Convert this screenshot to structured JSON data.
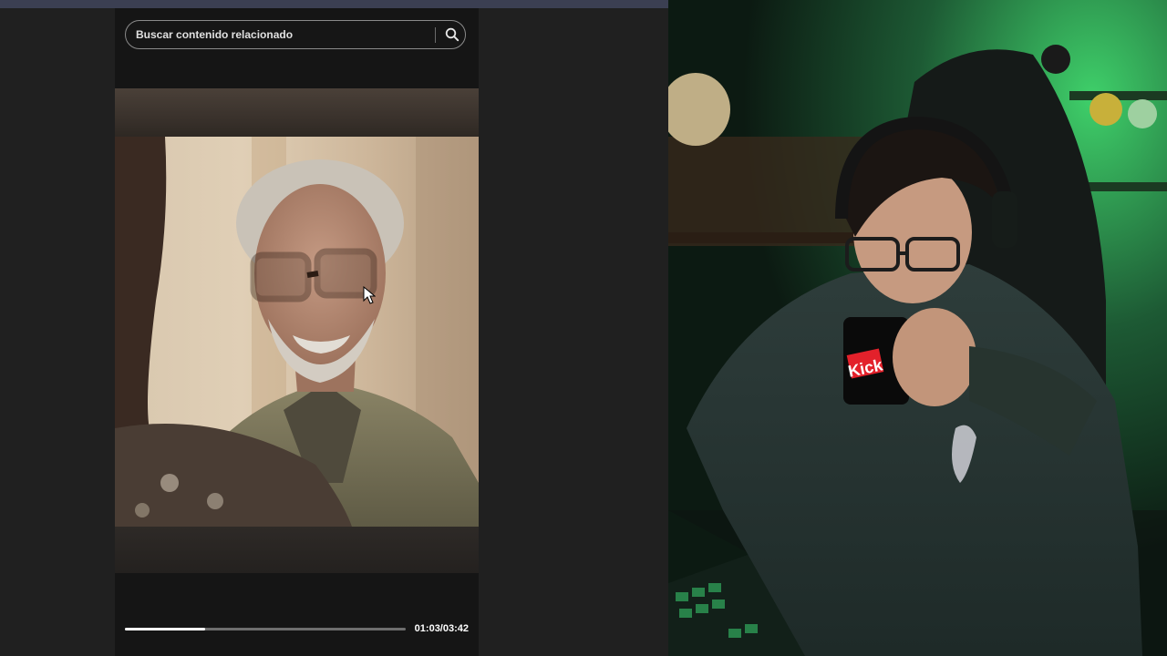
{
  "search": {
    "placeholder": "Buscar contenido relacionado",
    "icon": "search-icon"
  },
  "player": {
    "progress": 0.285,
    "time_label": "01:03/03:42"
  },
  "mug": {
    "text": "Kick"
  },
  "colors": {
    "accent_green": "#2fd36a",
    "background": "#202020",
    "topbar": "#3b3f52"
  }
}
